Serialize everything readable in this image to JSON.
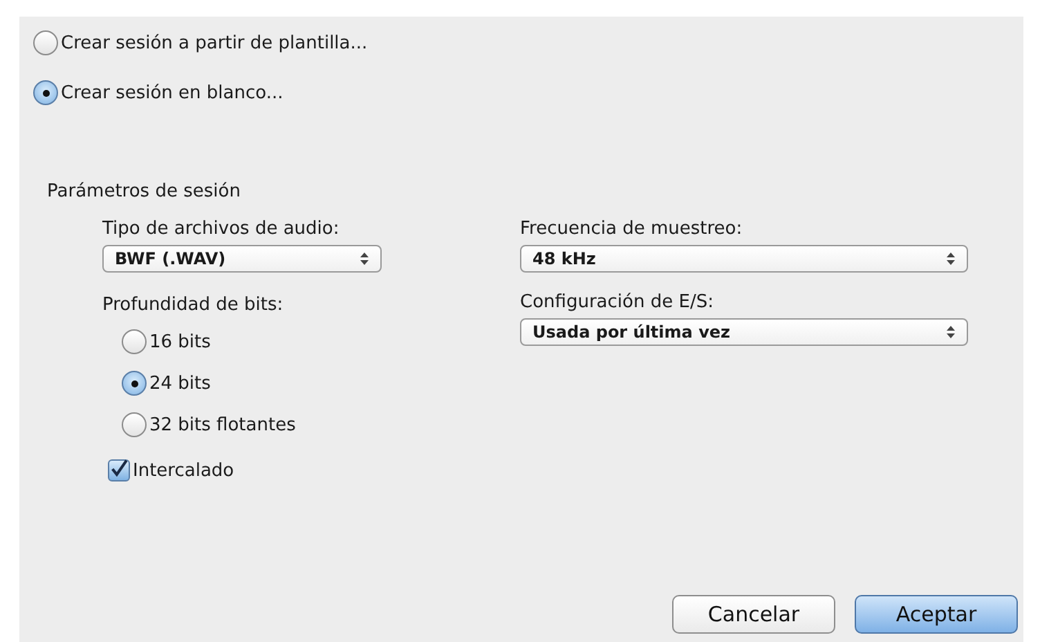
{
  "session_mode": [
    {
      "label": "Crear sesión a partir de plantilla...",
      "selected": false
    },
    {
      "label": "Crear sesión en blanco...",
      "selected": true
    }
  ],
  "parameters": {
    "title": "Parámetros de sesión",
    "audio_file_type": {
      "label": "Tipo de archivos de audio:",
      "value": "BWF (.WAV)"
    },
    "bit_depth": {
      "label": "Profundidad de bits:",
      "options": [
        {
          "label": "16 bits",
          "selected": false
        },
        {
          "label": "24 bits",
          "selected": true
        },
        {
          "label": "32 bits flotantes",
          "selected": false
        }
      ]
    },
    "interleaved": {
      "label": "Intercalado",
      "checked": true
    },
    "sample_rate": {
      "label": "Frecuencia de muestreo:",
      "value": "48 kHz"
    },
    "io_settings": {
      "label": "Configuración de E/S:",
      "value": "Usada por última vez"
    }
  },
  "buttons": [
    {
      "label": "Cancelar",
      "default": false
    },
    {
      "label": "Aceptar",
      "default": true
    }
  ]
}
